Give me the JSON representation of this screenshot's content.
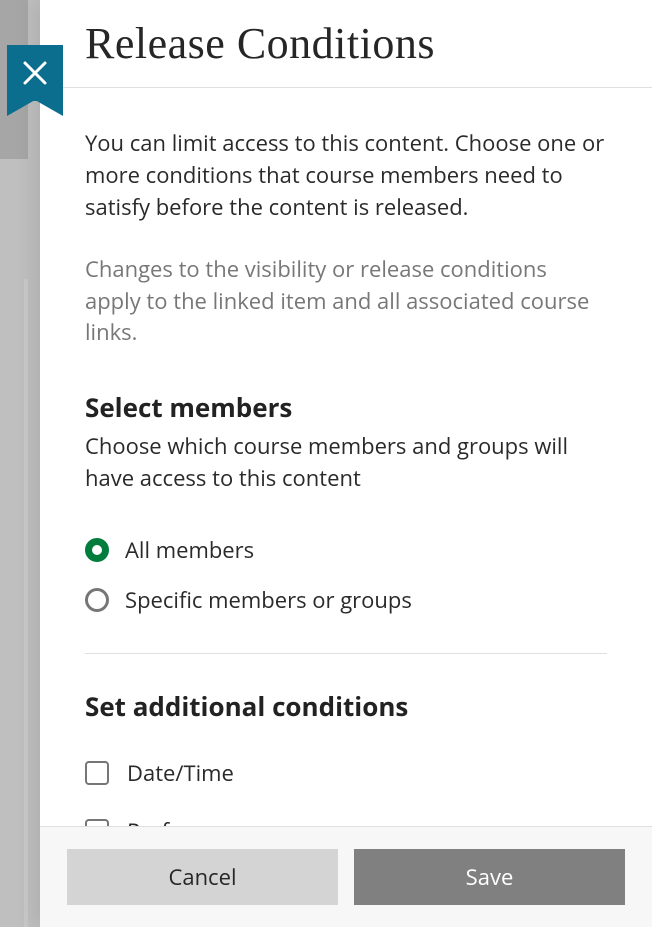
{
  "header": {
    "title": "Release Conditions"
  },
  "intro": "You can limit access to this content. Choose one or more conditions that course members need to satisfy before the content is released.",
  "note": "Changes to the visibility or release conditions apply to the linked item and all associated course links.",
  "members": {
    "heading": "Select members",
    "sub": "Choose which course members and groups will have access to this content",
    "options": [
      {
        "label": "All members",
        "selected": true
      },
      {
        "label": "Specific members or groups",
        "selected": false
      }
    ]
  },
  "additional": {
    "heading": "Set additional conditions",
    "options": [
      {
        "label": "Date/Time",
        "checked": false
      },
      {
        "label": "Performance",
        "checked": false
      }
    ]
  },
  "footer": {
    "cancel": "Cancel",
    "save": "Save"
  },
  "colors": {
    "accent_close": "#0b6e8f",
    "accent_radio": "#007d3c"
  }
}
